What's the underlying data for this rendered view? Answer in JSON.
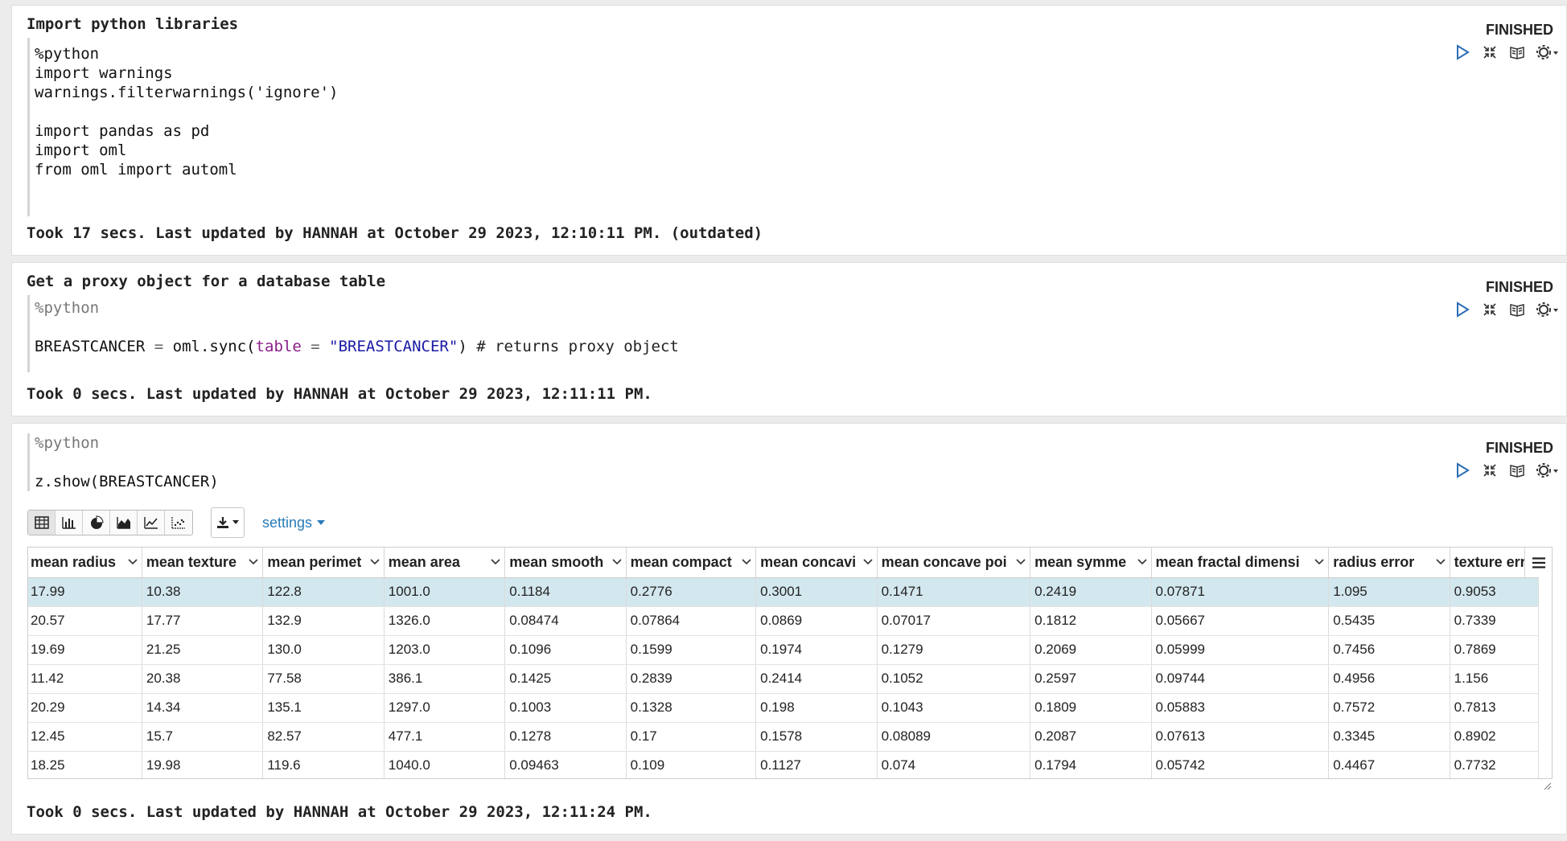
{
  "paragraphs": [
    {
      "title": "Import python libraries",
      "code": [
        "%python",
        "import warnings",
        "warnings.filterwarnings('ignore')",
        "",
        "import pandas as pd",
        "import oml",
        "from oml import automl"
      ],
      "status": "FINISHED",
      "footer": "Took 17 secs. Last updated by HANNAH at October 29 2023, 12:10:11 PM. (outdated)"
    },
    {
      "title": "Get a proxy object for a database table",
      "code": [
        "%python",
        "",
        "BREASTCANCER = oml.sync(table = \"BREASTCANCER\") # returns proxy object"
      ],
      "code_tokens": {
        "var": "BREASTCANCER",
        "eq": "=",
        "call": "oml.sync(",
        "kw": "table",
        "eq2": "=",
        "str": "\"BREASTCANCER\"",
        "close": ")",
        "comment": "# returns proxy object"
      },
      "status": "FINISHED",
      "footer": "Took 0 secs. Last updated by HANNAH at October 29 2023, 12:11:11 PM."
    },
    {
      "code": [
        "%python",
        "",
        "z.show(BREASTCANCER)"
      ],
      "status": "FINISHED",
      "footer": "Took 0 secs. Last updated by HANNAH at October 29 2023, 12:11:24 PM.",
      "toolbar": {
        "viz_icons": [
          "table-icon",
          "bar-chart-icon",
          "pie-chart-icon",
          "area-chart-icon",
          "line-chart-icon",
          "scatter-chart-icon"
        ],
        "settings_label": "settings"
      },
      "table": {
        "columns": [
          "mean radius",
          "mean texture",
          "mean perimeter",
          "mean area",
          "mean smoothness",
          "mean compactness",
          "mean concavity",
          "mean concave points",
          "mean symmetry",
          "mean fractal dimension",
          "radius error",
          "texture error"
        ],
        "header_display": [
          "mean radius",
          "mean texture",
          "mean perimet",
          "mean area",
          "mean smooth",
          "mean compact",
          "mean concavi",
          "mean concave poi",
          "mean symme",
          "mean fractal dimensi",
          "radius error",
          "texture err"
        ],
        "rows": [
          [
            "17.99",
            "10.38",
            "122.8",
            "1001.0",
            "0.1184",
            "0.2776",
            "0.3001",
            "0.1471",
            "0.2419",
            "0.07871",
            "1.095",
            "0.9053"
          ],
          [
            "20.57",
            "17.77",
            "132.9",
            "1326.0",
            "0.08474",
            "0.07864",
            "0.0869",
            "0.07017",
            "0.1812",
            "0.05667",
            "0.5435",
            "0.7339"
          ],
          [
            "19.69",
            "21.25",
            "130.0",
            "1203.0",
            "0.1096",
            "0.1599",
            "0.1974",
            "0.1279",
            "0.2069",
            "0.05999",
            "0.7456",
            "0.7869"
          ],
          [
            "11.42",
            "20.38",
            "77.58",
            "386.1",
            "0.1425",
            "0.2839",
            "0.2414",
            "0.1052",
            "0.2597",
            "0.09744",
            "0.4956",
            "1.156"
          ],
          [
            "20.29",
            "14.34",
            "135.1",
            "1297.0",
            "0.1003",
            "0.1328",
            "0.198",
            "0.1043",
            "0.1809",
            "0.05883",
            "0.7572",
            "0.7813"
          ],
          [
            "12.45",
            "15.7",
            "82.57",
            "477.1",
            "0.1278",
            "0.17",
            "0.1578",
            "0.08089",
            "0.2087",
            "0.07613",
            "0.3345",
            "0.8902"
          ],
          [
            "18.25",
            "19.98",
            "119.6",
            "1040.0",
            "0.09463",
            "0.109",
            "0.1127",
            "0.074",
            "0.1794",
            "0.05742",
            "0.4467",
            "0.7732"
          ]
        ],
        "selected_row": 0
      }
    }
  ],
  "colors": {
    "run": "#2b6cb5",
    "link": "#2a7bb8",
    "selected_row": "#d3e7ee"
  }
}
